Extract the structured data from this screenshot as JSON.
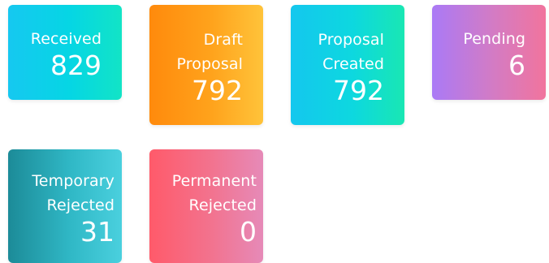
{
  "cards": [
    {
      "label_lines": [
        "Received"
      ],
      "value": "829",
      "colors": [
        "#16c8f0",
        "#12e4c6"
      ]
    },
    {
      "label_lines": [
        "Draft",
        "Proposal"
      ],
      "value": "792",
      "colors": [
        "#ff8a0c",
        "#ffc33a"
      ]
    },
    {
      "label_lines": [
        "Proposal",
        "Created"
      ],
      "value": "792",
      "colors": [
        "#14c7ee",
        "#19e7b3"
      ]
    },
    {
      "label_lines": [
        "Pending"
      ],
      "value": "6",
      "colors": [
        "#aa7af6",
        "#f1749d"
      ]
    },
    {
      "label_lines": [
        "Temporary",
        "Rejected"
      ],
      "value": "31",
      "colors": [
        "#1c8b98",
        "#4ad0de"
      ]
    },
    {
      "label_lines": [
        "Permanent",
        "Rejected"
      ],
      "value": "0",
      "colors": [
        "#ff5a6a",
        "#e68ab8"
      ]
    }
  ]
}
